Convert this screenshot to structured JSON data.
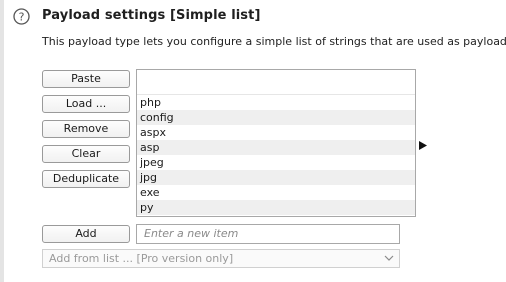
{
  "header": {
    "title": "Payload settings [Simple list]",
    "description": "This payload type lets you configure a simple list of strings that are used as payloads."
  },
  "buttons": {
    "paste": "Paste",
    "load": "Load ...",
    "remove": "Remove",
    "clear": "Clear",
    "deduplicate": "Deduplicate",
    "add": "Add"
  },
  "list": {
    "items": [
      "php",
      "config",
      "aspx",
      "asp",
      "jpeg",
      "jpg",
      "exe",
      "py"
    ]
  },
  "add_item": {
    "placeholder": "Enter a new item"
  },
  "add_from_list": {
    "value": "Add from list ... [Pro version only]"
  },
  "icons": {
    "help": "question-circle-icon",
    "arrow": "play-arrow-icon",
    "chevron": "chevron-down-icon"
  },
  "colors": {
    "accent": "#1f1f1f",
    "row_alt": "#efefef"
  }
}
